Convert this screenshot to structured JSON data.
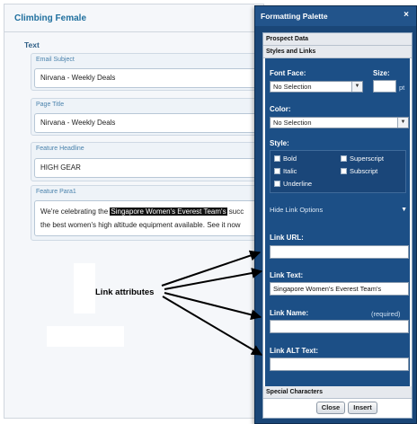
{
  "editor": {
    "title": "Climbing Female",
    "section": "Text",
    "fields": [
      {
        "label": "Email Subject",
        "value": "Nirvana - Weekly Deals"
      },
      {
        "label": "Page Title",
        "value": "Nirvana - Weekly Deals"
      },
      {
        "label": "Feature Headline",
        "value": "HIGH GEAR"
      }
    ],
    "para": {
      "label": "Feature Para1",
      "line1_before": "We're celebrating the ",
      "line1_highlight": "Singapore Women's Everest Team's",
      "line1_after": " succ",
      "line2": "the best women's high altitude equipment available. See it now"
    }
  },
  "annotation": {
    "label": "Link attributes"
  },
  "palette": {
    "title": "Formatting Palette",
    "close_glyph": "×",
    "sections": {
      "prospect": "Prospect Data",
      "styles": "Styles and Links",
      "special": "Special Characters"
    },
    "font_face_label": "Font Face:",
    "font_face_value": "No Selection",
    "size_label": "Size:",
    "size_unit": "pt",
    "color_label": "Color:",
    "color_value": "No Selection",
    "style_label": "Style:",
    "styles": [
      "Bold",
      "Superscript",
      "Italic",
      "Subscript",
      "Underline"
    ],
    "hide_link": "Hide Link Options",
    "link_url_label": "Link URL:",
    "link_url_value": "",
    "link_text_label": "Link Text:",
    "link_text_value": "Singapore Women's Everest Team's",
    "link_name_label": "Link Name:",
    "link_name_required": "(required)",
    "link_name_value": "",
    "link_alt_label": "Link ALT Text:",
    "link_alt_value": "",
    "close_button": "Close",
    "insert_button": "Insert"
  },
  "colors": {
    "palette_bg": "#1a4677",
    "title_blue": "#1f6f9e"
  }
}
